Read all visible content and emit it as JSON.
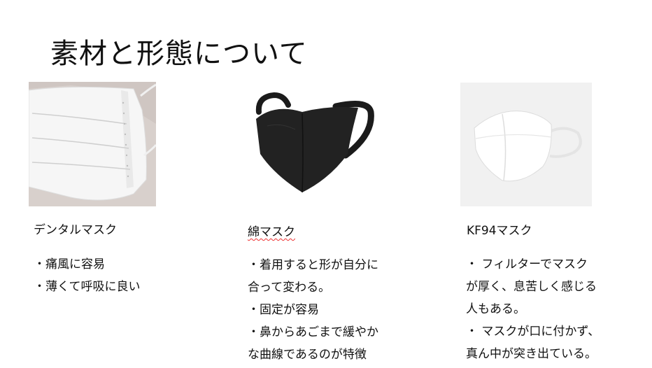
{
  "slide": {
    "title": "素材と形態について",
    "columns": [
      {
        "label": "デンタルマスク",
        "bullets": [
          "・痛風に容易",
          "・薄くて呼吸に良い"
        ]
      },
      {
        "label": "綿マスク",
        "bullets": [
          "・着用すると形が自分に",
          "合って変わる。",
          "・固定が容易",
          "・鼻からあごまで緩やか",
          "な曲線であるのが特徴"
        ]
      },
      {
        "label": "KF94マスク",
        "bullets": [
          "・ フィルターでマスク",
          "が厚く、息苦しく感じる",
          "人もある。",
          "・ マスクが口に付かず、",
          "真ん中が突き出ている。"
        ]
      }
    ]
  }
}
